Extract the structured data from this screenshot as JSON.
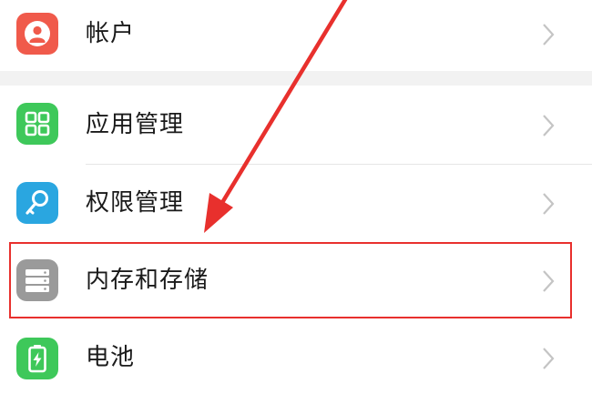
{
  "settings": {
    "items": [
      {
        "label": "帐户",
        "icon": "account-icon",
        "color": "#f05a4b"
      },
      {
        "label": "应用管理",
        "icon": "apps-grid-icon",
        "color": "#3ec85a"
      },
      {
        "label": "权限管理",
        "icon": "key-icon",
        "color": "#2aa6e0"
      },
      {
        "label": "内存和存储",
        "icon": "storage-icon",
        "color": "#9a9a9a",
        "highlighted": true
      },
      {
        "label": "电池",
        "icon": "battery-icon",
        "color": "#3ec85a"
      }
    ]
  },
  "colors": {
    "annotation": "#e8302d",
    "divider": "#e6e6e6",
    "section_gap": "#f2f2f2",
    "chevron": "#c4c4c4"
  }
}
